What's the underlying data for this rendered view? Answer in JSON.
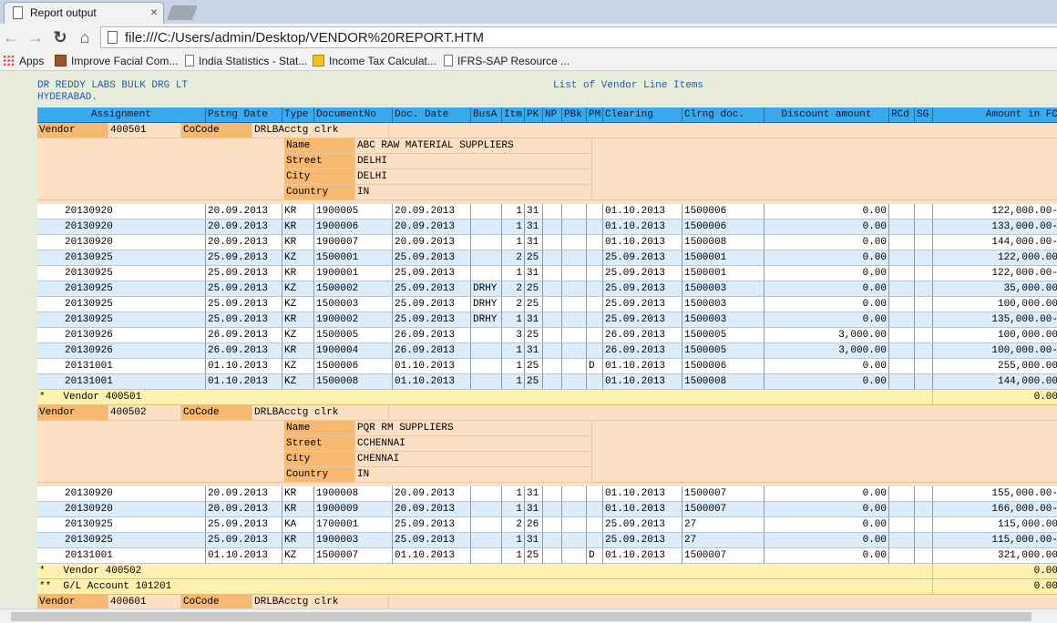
{
  "browser": {
    "tab_title": "Report output",
    "tab_close": "×",
    "url": "file:///C:/Users/admin/Desktop/VENDOR%20REPORT.HTM",
    "bookmarks": [
      {
        "label": "Apps",
        "icon": "apps-grid-icon"
      },
      {
        "label": "Improve Facial Com...",
        "icon": "face-thumbnail-icon"
      },
      {
        "label": "India Statistics - Stat...",
        "icon": "page-icon"
      },
      {
        "label": "Income Tax Calculat...",
        "icon": "calculator-icon"
      },
      {
        "label": "IFRS-SAP Resource ...",
        "icon": "page-icon"
      }
    ]
  },
  "report": {
    "company_line1": "DR REDDY LABS BULK DRG LT",
    "company_line2": "HYDERABAD.",
    "title": "List of Vendor Line Items",
    "columns": [
      "Assignment",
      "Pstng Date",
      "Type",
      "DocumentNo",
      "Doc. Date",
      "BusA",
      "Itm",
      "PK",
      "NP",
      "PBk",
      "PM",
      "Clearing",
      "Clrng doc.",
      "Discount amount",
      "RCd",
      "SG",
      "Amount in FC"
    ],
    "labels": {
      "vendor": "Vendor",
      "cocode": "CoCode",
      "name": "Name",
      "street": "Street",
      "city": "City",
      "country": "Country"
    },
    "vendors": [
      {
        "vendor_no": "400501",
        "cocode": "DRLBAcctg clrk",
        "name": "ABC RAW MATERIAL SUPPLIERS",
        "street": "DELHI",
        "city": "DELHI",
        "country": "IN",
        "rows": [
          [
            "20130920",
            "20.09.2013",
            "KR",
            "1900005",
            "20.09.2013",
            "",
            "1",
            "31",
            "",
            "",
            "",
            "01.10.2013",
            "1500006",
            "0.00",
            "",
            "",
            "122,000.00-"
          ],
          [
            "20130920",
            "20.09.2013",
            "KR",
            "1900006",
            "20.09.2013",
            "",
            "1",
            "31",
            "",
            "",
            "",
            "01.10.2013",
            "1500006",
            "0.00",
            "",
            "",
            "133,000.00-"
          ],
          [
            "20130920",
            "20.09.2013",
            "KR",
            "1900007",
            "20.09.2013",
            "",
            "1",
            "31",
            "",
            "",
            "",
            "01.10.2013",
            "1500008",
            "0.00",
            "",
            "",
            "144,000.00-"
          ],
          [
            "20130925",
            "25.09.2013",
            "KZ",
            "1500001",
            "25.09.2013",
            "",
            "2",
            "25",
            "",
            "",
            "",
            "25.09.2013",
            "1500001",
            "0.00",
            "",
            "",
            "122,000.00"
          ],
          [
            "20130925",
            "25.09.2013",
            "KR",
            "1900001",
            "25.09.2013",
            "",
            "1",
            "31",
            "",
            "",
            "",
            "25.09.2013",
            "1500001",
            "0.00",
            "",
            "",
            "122,000.00-"
          ],
          [
            "20130925",
            "25.09.2013",
            "KZ",
            "1500002",
            "25.09.2013",
            "DRHY",
            "2",
            "25",
            "",
            "",
            "",
            "25.09.2013",
            "1500003",
            "0.00",
            "",
            "",
            "35,000.00"
          ],
          [
            "20130925",
            "25.09.2013",
            "KZ",
            "1500003",
            "25.09.2013",
            "DRHY",
            "2",
            "25",
            "",
            "",
            "",
            "25.09.2013",
            "1500003",
            "0.00",
            "",
            "",
            "100,000.00"
          ],
          [
            "20130925",
            "25.09.2013",
            "KR",
            "1900002",
            "25.09.2013",
            "DRHY",
            "1",
            "31",
            "",
            "",
            "",
            "25.09.2013",
            "1500003",
            "0.00",
            "",
            "",
            "135,000.00-"
          ],
          [
            "20130926",
            "26.09.2013",
            "KZ",
            "1500005",
            "26.09.2013",
            "",
            "3",
            "25",
            "",
            "",
            "",
            "26.09.2013",
            "1500005",
            "3,000.00",
            "",
            "",
            "100,000.00"
          ],
          [
            "20130926",
            "26.09.2013",
            "KR",
            "1900004",
            "26.09.2013",
            "",
            "1",
            "31",
            "",
            "",
            "",
            "26.09.2013",
            "1500005",
            "3,000.00",
            "",
            "",
            "100,000.00-"
          ],
          [
            "20131001",
            "01.10.2013",
            "KZ",
            "1500006",
            "01.10.2013",
            "",
            "1",
            "25",
            "",
            "",
            "D",
            "01.10.2013",
            "1500006",
            "0.00",
            "",
            "",
            "255,000.00"
          ],
          [
            "20131001",
            "01.10.2013",
            "KZ",
            "1500008",
            "01.10.2013",
            "",
            "1",
            "25",
            "",
            "",
            "",
            "01.10.2013",
            "1500008",
            "0.00",
            "",
            "",
            "144,000.00"
          ]
        ],
        "total_label": "*   Vendor 400501",
        "total_amount": "0.00"
      },
      {
        "vendor_no": "400502",
        "cocode": "DRLBAcctg clrk",
        "name": "PQR RM SUPPLIERS",
        "street": "CCHENNAI",
        "city": "CHENNAI",
        "country": "IN",
        "rows": [
          [
            "20130920",
            "20.09.2013",
            "KR",
            "1900008",
            "20.09.2013",
            "",
            "1",
            "31",
            "",
            "",
            "",
            "01.10.2013",
            "1500007",
            "0.00",
            "",
            "",
            "155,000.00-"
          ],
          [
            "20130920",
            "20.09.2013",
            "KR",
            "1900009",
            "20.09.2013",
            "",
            "1",
            "31",
            "",
            "",
            "",
            "01.10.2013",
            "1500007",
            "0.00",
            "",
            "",
            "166,000.00-"
          ],
          [
            "20130925",
            "25.09.2013",
            "KA",
            "1700001",
            "25.09.2013",
            "",
            "2",
            "26",
            "",
            "",
            "",
            "25.09.2013",
            "27",
            "0.00",
            "",
            "",
            "115,000.00"
          ],
          [
            "20130925",
            "25.09.2013",
            "KR",
            "1900003",
            "25.09.2013",
            "",
            "1",
            "31",
            "",
            "",
            "",
            "25.09.2013",
            "27",
            "0.00",
            "",
            "",
            "115,000.00-"
          ],
          [
            "20131001",
            "01.10.2013",
            "KZ",
            "1500007",
            "01.10.2013",
            "",
            "1",
            "25",
            "",
            "",
            "D",
            "01.10.2013",
            "1500007",
            "0.00",
            "",
            "",
            "321,000.00"
          ]
        ],
        "total_label": "*   Vendor 400502",
        "total_amount": "0.00"
      }
    ],
    "gl_total_label": "**  G/L Account 101201",
    "gl_total_amount": "0.00",
    "next_vendor": {
      "vendor_no": "400601",
      "cocode": "DRLBAcctg clrk"
    }
  }
}
